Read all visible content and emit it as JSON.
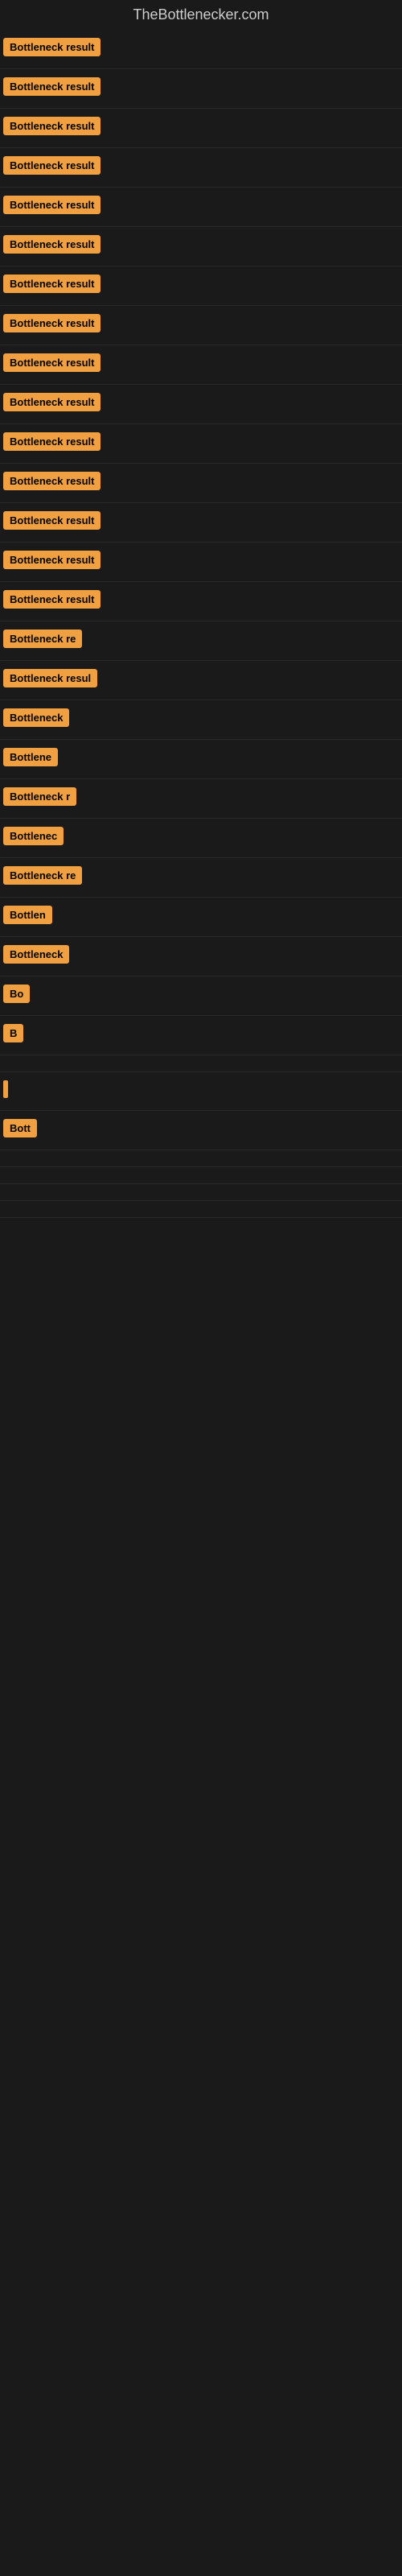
{
  "site": {
    "title": "TheBottlenecker.com"
  },
  "rows": [
    {
      "id": 1,
      "label": "Bottleneck result",
      "width": 130
    },
    {
      "id": 2,
      "label": "Bottleneck result",
      "width": 130
    },
    {
      "id": 3,
      "label": "Bottleneck result",
      "width": 130
    },
    {
      "id": 4,
      "label": "Bottleneck result",
      "width": 130
    },
    {
      "id": 5,
      "label": "Bottleneck result",
      "width": 130
    },
    {
      "id": 6,
      "label": "Bottleneck result",
      "width": 130
    },
    {
      "id": 7,
      "label": "Bottleneck result",
      "width": 130
    },
    {
      "id": 8,
      "label": "Bottleneck result",
      "width": 130
    },
    {
      "id": 9,
      "label": "Bottleneck result",
      "width": 130
    },
    {
      "id": 10,
      "label": "Bottleneck result",
      "width": 130
    },
    {
      "id": 11,
      "label": "Bottleneck result",
      "width": 130
    },
    {
      "id": 12,
      "label": "Bottleneck result",
      "width": 130
    },
    {
      "id": 13,
      "label": "Bottleneck result",
      "width": 130
    },
    {
      "id": 14,
      "label": "Bottleneck result",
      "width": 130
    },
    {
      "id": 15,
      "label": "Bottleneck result",
      "width": 120
    },
    {
      "id": 16,
      "label": "Bottleneck re",
      "width": 100
    },
    {
      "id": 17,
      "label": "Bottleneck resul",
      "width": 110
    },
    {
      "id": 18,
      "label": "Bottleneck",
      "width": 85
    },
    {
      "id": 19,
      "label": "Bottlene",
      "width": 72
    },
    {
      "id": 20,
      "label": "Bottleneck r",
      "width": 90
    },
    {
      "id": 21,
      "label": "Bottlenec",
      "width": 78
    },
    {
      "id": 22,
      "label": "Bottleneck re",
      "width": 100
    },
    {
      "id": 23,
      "label": "Bottlen",
      "width": 65
    },
    {
      "id": 24,
      "label": "Bottleneck",
      "width": 85
    },
    {
      "id": 25,
      "label": "Bo",
      "width": 30
    },
    {
      "id": 26,
      "label": "B",
      "width": 18
    },
    {
      "id": 27,
      "label": "",
      "width": 8
    },
    {
      "id": 28,
      "label": "|",
      "width": 6
    },
    {
      "id": 29,
      "label": "Bott",
      "width": 38
    },
    {
      "id": 30,
      "label": "",
      "width": 0
    },
    {
      "id": 31,
      "label": "",
      "width": 0
    },
    {
      "id": 32,
      "label": "",
      "width": 0
    },
    {
      "id": 33,
      "label": "",
      "width": 0
    }
  ]
}
